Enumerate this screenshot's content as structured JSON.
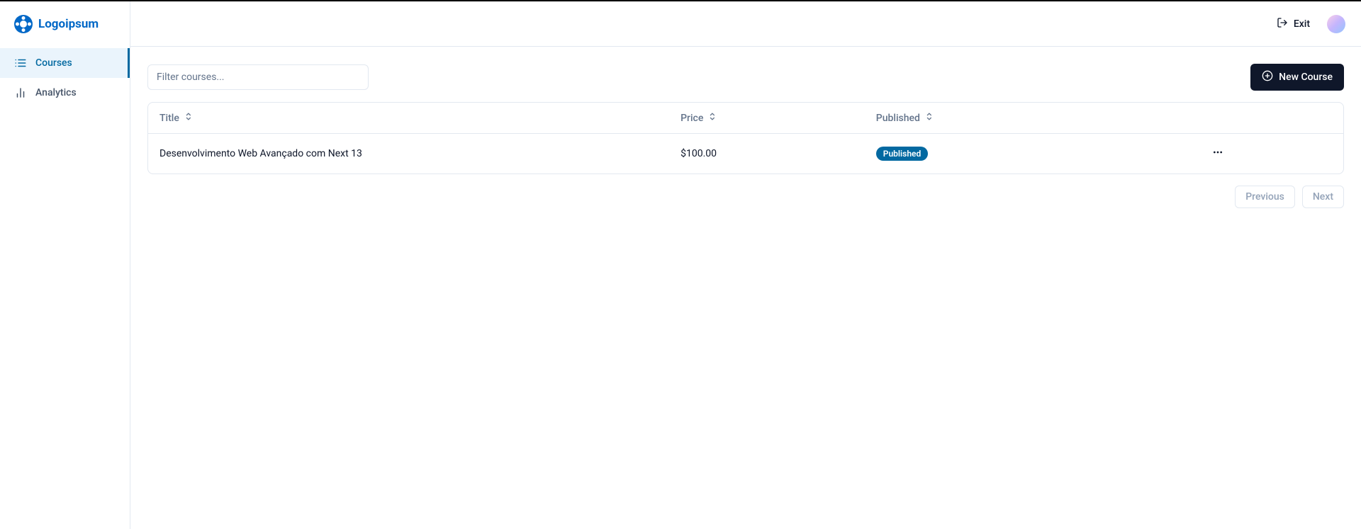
{
  "brand": {
    "name": "Logoipsum"
  },
  "sidebar": {
    "items": [
      {
        "label": "Courses"
      },
      {
        "label": "Analytics"
      }
    ]
  },
  "header": {
    "exit_label": "Exit"
  },
  "toolbar": {
    "filter_placeholder": "Filter courses...",
    "new_course_label": "New Course"
  },
  "table": {
    "columns": {
      "title": "Title",
      "price": "Price",
      "published": "Published"
    },
    "rows": [
      {
        "title": "Desenvolvimento Web Avançado com Next 13",
        "price": "$100.00",
        "published_badge": "Published"
      }
    ]
  },
  "pagination": {
    "previous": "Previous",
    "next": "Next"
  }
}
